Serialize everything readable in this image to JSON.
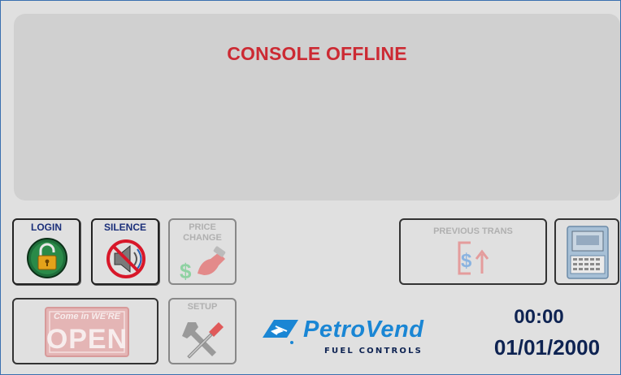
{
  "display": {
    "status": "CONSOLE OFFLINE"
  },
  "buttons": {
    "login": "LOGIN",
    "silence": "SILENCE",
    "price_change": "PRICE CHANGE",
    "previous_trans": "PREVIOUS TRANS",
    "setup": "SETUP",
    "open_sign_top": "Come in WE'RE",
    "open_sign_main": "OPEN"
  },
  "brand": {
    "name": "PetroVend",
    "tagline": "FUEL CONTROLS"
  },
  "clock": {
    "time": "00:00",
    "date": "01/01/2000"
  },
  "icons": {
    "login": "padlock-icon",
    "silence": "speaker-muted-icon",
    "price_change": "fuel-nozzle-dollar-icon",
    "previous_trans": "dollar-arrow-icon",
    "terminal": "terminal-device-icon",
    "setup": "wrench-screwdriver-icon",
    "open_sign": "open-sign-icon",
    "brand": "petrovend-logo-icon"
  },
  "colors": {
    "status_text": "#cc2a33",
    "label_text": "#1b2f7a",
    "clock_text": "#0e2352",
    "brand_blue": "#1a86d4"
  }
}
